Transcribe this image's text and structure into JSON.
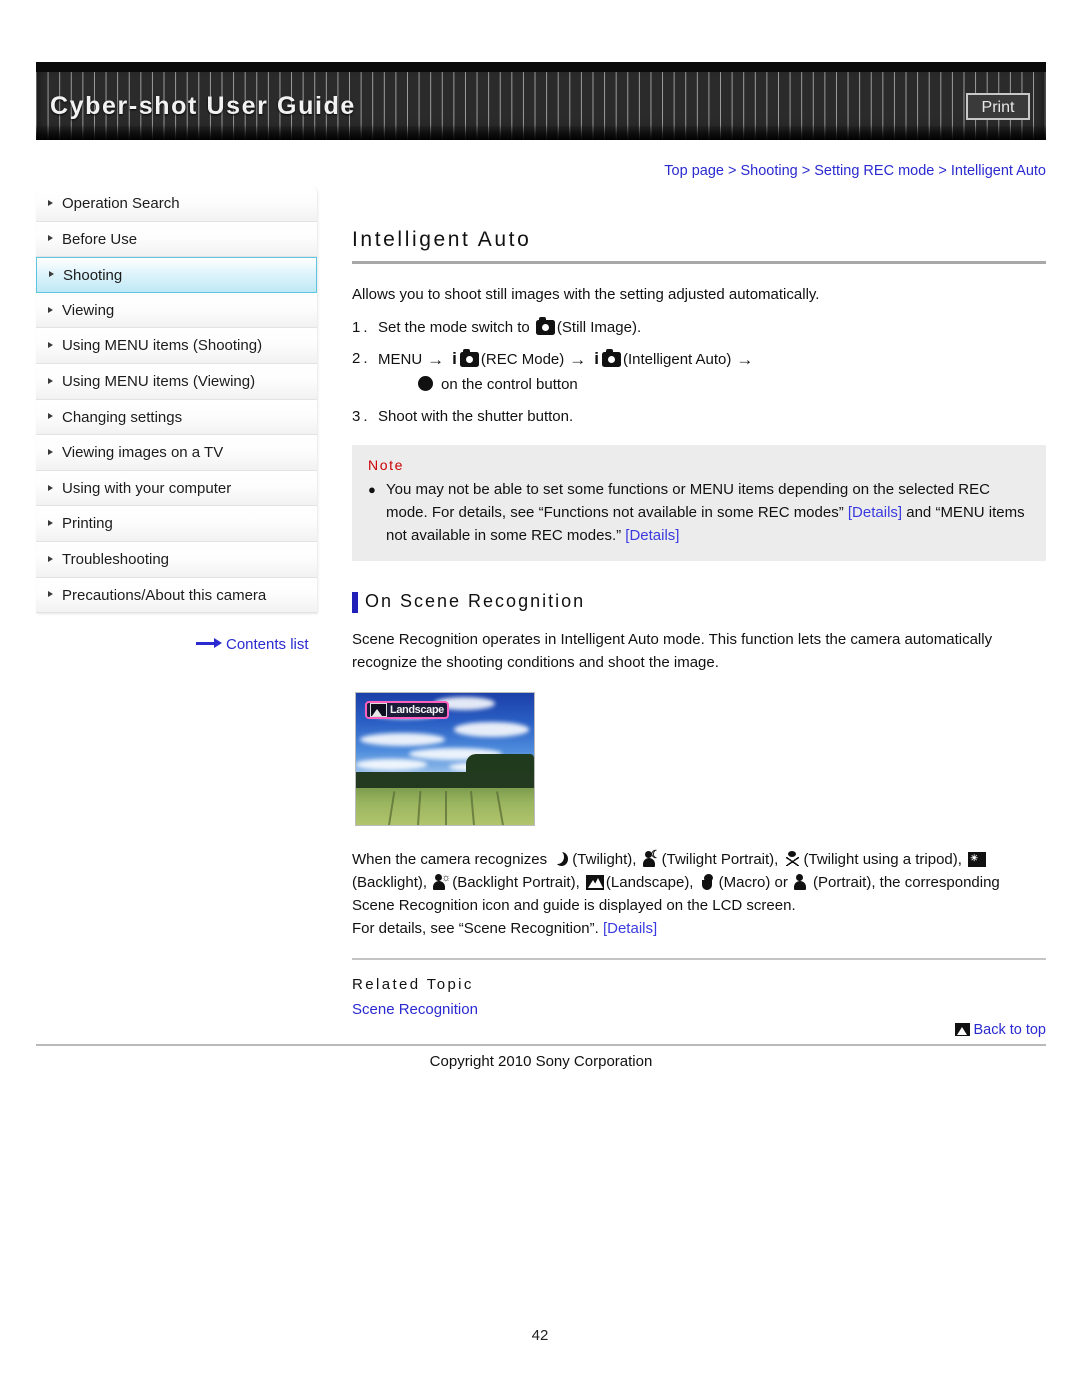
{
  "header": {
    "title": "Cyber-shot User Guide",
    "print_label": "Print"
  },
  "breadcrumb": {
    "items": [
      "Top page",
      "Shooting",
      "Setting REC mode",
      "Intelligent Auto"
    ],
    "separator": ">",
    "text": "Top page > Shooting > Setting REC mode > Intelligent Auto"
  },
  "sidebar": {
    "items": [
      {
        "label": "Operation Search",
        "selected": false
      },
      {
        "label": "Before Use",
        "selected": false
      },
      {
        "label": "Shooting",
        "selected": true
      },
      {
        "label": "Viewing",
        "selected": false
      },
      {
        "label": "Using MENU items (Shooting)",
        "selected": false
      },
      {
        "label": "Using MENU items (Viewing)",
        "selected": false
      },
      {
        "label": "Changing settings",
        "selected": false
      },
      {
        "label": "Viewing images on a TV",
        "selected": false
      },
      {
        "label": "Using with your computer",
        "selected": false
      },
      {
        "label": "Printing",
        "selected": false
      },
      {
        "label": "Troubleshooting",
        "selected": false
      },
      {
        "label": "Precautions/About this camera",
        "selected": false
      }
    ],
    "contents_list_label": "Contents list",
    "selected_bg": "#bfe9f6",
    "selected_border": "#5ec4e0"
  },
  "main": {
    "title": "Intelligent Auto",
    "intro": "Allows you to shoot still images with the setting adjusted automatically.",
    "steps": [
      {
        "num": "1.",
        "text_before": "Set the mode switch to",
        "icon": "camera-icon",
        "text_after": "(Still Image)."
      },
      {
        "num": "2.",
        "menu_label": "MENU",
        "arrow": "→",
        "icon1": "i-camera-icon",
        "label1": "(REC Mode)",
        "icon2": "i-camera-icon",
        "label2": "(Intelligent Auto)",
        "sub_icon": "control-button-center-dot",
        "sub_text": "on the control button"
      },
      {
        "num": "3.",
        "text_before": "Shoot with the shutter button."
      }
    ],
    "note": {
      "label": "Note",
      "bullet": "●",
      "part1": "You may not be able to set some functions or MENU items depending on the selected REC mode. For details, see “Functions not available in some REC modes”",
      "link1": "[Details]",
      "part2": "and “MENU items not available in some REC modes.”",
      "link2": "[Details]",
      "label_color": "#cc0000",
      "bg_color": "#ececec",
      "link_color": "#3a3ae0"
    },
    "section": {
      "heading": "On Scene Recognition",
      "accent_color": "#2020b8",
      "paragraph": "Scene Recognition operates in Intelligent Auto mode. This function lets the camera automatically recognize the shooting conditions and shoot the image."
    },
    "photo": {
      "alt": "Landscape scene on LCD screen",
      "tag_label": "Landscape",
      "tag_icon": "landscape-icon",
      "tag_border_color": "#ff5fbf"
    },
    "scene_paragraph": {
      "lead": "When the camera recognizes",
      "icons": [
        {
          "name": "twilight-icon",
          "label": "(Twilight),"
        },
        {
          "name": "twilight-portrait-icon",
          "label": "(Twilight Portrait),"
        },
        {
          "name": "twilight-tripod-icon",
          "label": "(Twilight using a tripod),"
        },
        {
          "name": "backlight-icon",
          "label": "(Backlight),"
        },
        {
          "name": "backlight-portrait-icon",
          "label": "(Backlight Portrait),"
        },
        {
          "name": "landscape-icon",
          "label": "(Landscape),"
        },
        {
          "name": "macro-icon",
          "label": "(Macro) or"
        },
        {
          "name": "portrait-icon",
          "label": "(Portrait), the"
        }
      ],
      "tail": "corresponding Scene Recognition icon and guide is displayed on the LCD screen.",
      "details_lead": "For details, see “Scene Recognition”.",
      "details_link": "[Details]"
    },
    "related": {
      "label": "Related Topic",
      "link": "Scene Recognition"
    }
  },
  "footer": {
    "back_to_top": "Back to top",
    "copyright": "Copyright 2010 Sony Corporation",
    "page_number": "42"
  }
}
